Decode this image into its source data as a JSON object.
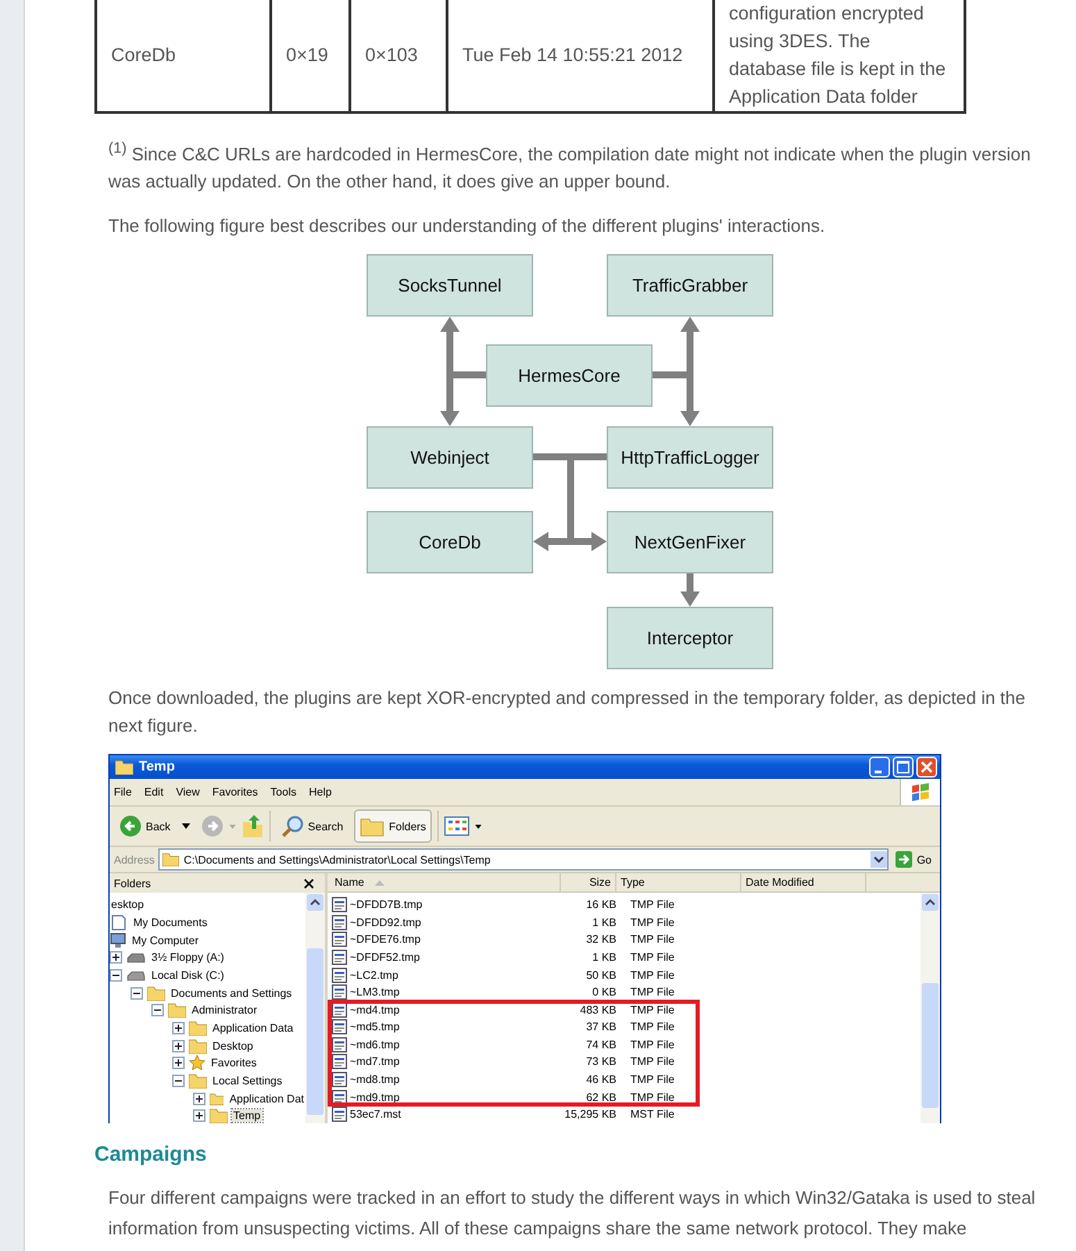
{
  "table": {
    "rows": [
      {
        "cells": [
          "CoreDb",
          "0×19",
          "0×103",
          "Tue Feb 14 10:55:21 2012",
          "configuration encrypted using 3DES. The database file is kept in the Application Data folder"
        ]
      }
    ]
  },
  "footnote": "$^{(1)}$ Since C&C URLs are hardcoded in HermesCore, the compilation date might not indicate when the plugin version was actually updated. On the other hand, it does give an upper bound.",
  "figure_intro": "The following figure best describes our understanding of the different plugins' interactions.",
  "diagram": {
    "nodes": [
      "SocksTunnel",
      "TrafficGrabber",
      "HermesCore",
      "Webinject",
      "HttpTrafficLogger",
      "CoreDb",
      "NextGenFixer",
      "Interceptor"
    ]
  },
  "screenshot_intro": "Once downloaded, the plugins are kept XOR-encrypted and compressed in the temporary folder, as depicted in the next figure.",
  "explorer": {
    "title": "Temp",
    "menu": [
      "File",
      "Edit",
      "View",
      "Favorites",
      "Tools",
      "Help"
    ],
    "toolbar": {
      "back": "Back",
      "search": "Search",
      "folders": "Folders"
    },
    "address_label": "Address",
    "address": "C:\\Documents and Settings\\Administrator\\Local Settings\\Temp",
    "go": "Go",
    "folders_title": "Folders",
    "folders": [
      {
        "name": "esktop",
        "selected": false,
        "children": [
          {
            "name": "My Documents",
            "kind": "documents",
            "selected": false
          },
          {
            "name": "My Computer",
            "kind": "computer",
            "selected": false,
            "children": [
              {
                "name": "3½ Floppy (A:)",
                "kind": "floppy",
                "expanded": false,
                "selected": false
              },
              {
                "name": "Local Disk (C:)",
                "kind": "disk",
                "expanded": true,
                "selected": false,
                "children": [
                  {
                    "name": "Documents and Settings",
                    "kind": "folder",
                    "expanded": true,
                    "selected": false,
                    "children": [
                      {
                        "name": "Administrator",
                        "kind": "folder",
                        "expanded": true,
                        "selected": false,
                        "children": [
                          {
                            "name": "Application Data",
                            "kind": "folder",
                            "expanded": false,
                            "selected": false
                          },
                          {
                            "name": "Desktop",
                            "kind": "folder",
                            "expanded": false,
                            "selected": false
                          },
                          {
                            "name": "Favorites",
                            "kind": "favorites",
                            "expanded": false,
                            "selected": false
                          },
                          {
                            "name": "Local Settings",
                            "kind": "folder",
                            "expanded": true,
                            "selected": false,
                            "children": [
                              {
                                "name": "Application Dat",
                                "kind": "folder",
                                "expanded": false,
                                "selected": false
                              },
                              {
                                "name": "Temp",
                                "kind": "folder",
                                "expanded": false,
                                "selected": true
                              }
                            ]
                          }
                        ]
                      }
                    ]
                  }
                ]
              }
            ]
          }
        ]
      }
    ],
    "columns": [
      "Name",
      "Size",
      "Type",
      "Date Modified"
    ],
    "files": [
      {
        "name": "~DFDD7B.tmp",
        "size": "16 KB",
        "type": "TMP File",
        "marked": false
      },
      {
        "name": "~DFDD92.tmp",
        "size": "1 KB",
        "type": "TMP File",
        "marked": false
      },
      {
        "name": "~DFDE76.tmp",
        "size": "32 KB",
        "type": "TMP File",
        "marked": false
      },
      {
        "name": "~DFDF52.tmp",
        "size": "1 KB",
        "type": "TMP File",
        "marked": false
      },
      {
        "name": "~LC2.tmp",
        "size": "50 KB",
        "type": "TMP File",
        "marked": false
      },
      {
        "name": "~LM3.tmp",
        "size": "0 KB",
        "type": "TMP File",
        "marked": false
      },
      {
        "name": "~md4.tmp",
        "size": "483 KB",
        "type": "TMP File",
        "marked": true
      },
      {
        "name": "~md5.tmp",
        "size": "37 KB",
        "type": "TMP File",
        "marked": true
      },
      {
        "name": "~md6.tmp",
        "size": "74 KB",
        "type": "TMP File",
        "marked": true
      },
      {
        "name": "~md7.tmp",
        "size": "73 KB",
        "type": "TMP File",
        "marked": true
      },
      {
        "name": "~md8.tmp",
        "size": "46 KB",
        "type": "TMP File",
        "marked": true
      },
      {
        "name": "~md9.tmp",
        "size": "62 KB",
        "type": "TMP File",
        "marked": true
      },
      {
        "name": "53ec7.mst",
        "size": "15,295 KB",
        "type": "MST File",
        "marked": false
      }
    ]
  },
  "section_heading": "Campaigns",
  "section_text": "Four different campaigns were tracked in an effort to study the different ways in which Win32/Gataka is used to steal information from unsuspecting victims. All of these campaigns share the same network protocol. They make"
}
